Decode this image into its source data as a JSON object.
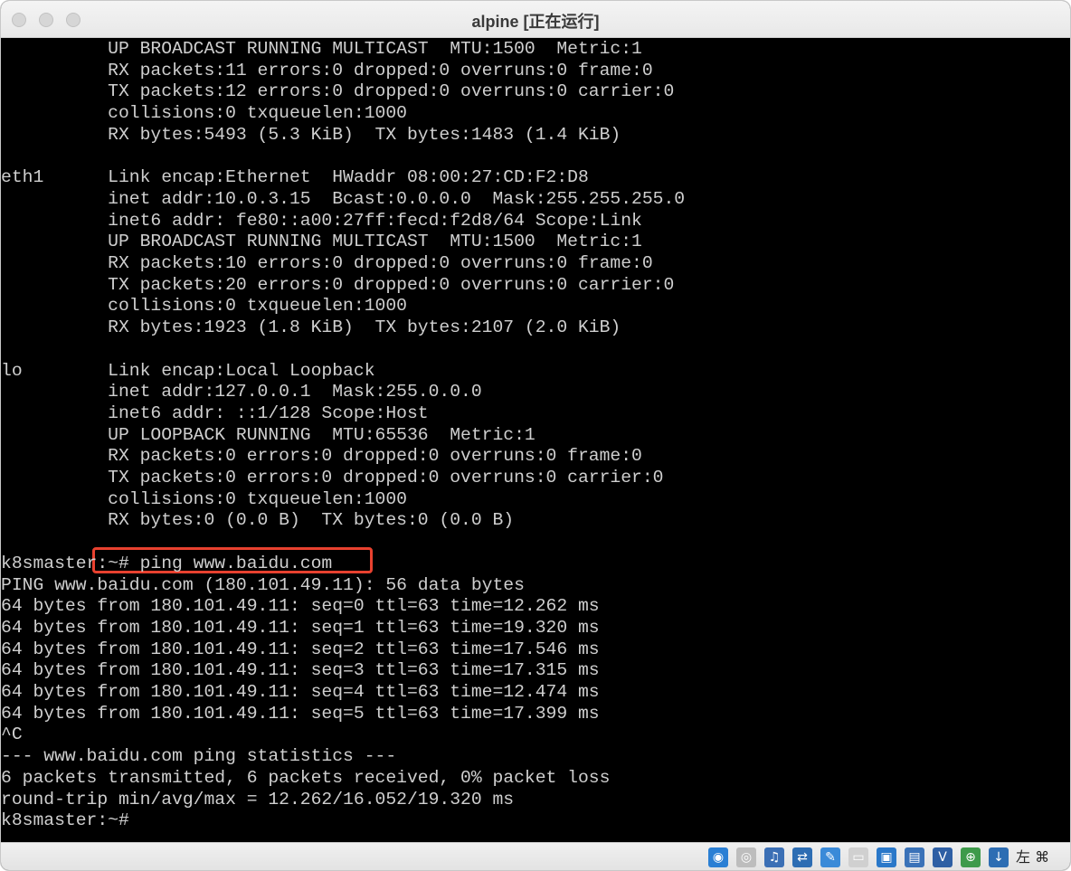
{
  "window": {
    "title": "alpine [正在运行]"
  },
  "terminal": {
    "lines": [
      "          UP BROADCAST RUNNING MULTICAST  MTU:1500  Metric:1",
      "          RX packets:11 errors:0 dropped:0 overruns:0 frame:0",
      "          TX packets:12 errors:0 dropped:0 overruns:0 carrier:0",
      "          collisions:0 txqueuelen:1000",
      "          RX bytes:5493 (5.3 KiB)  TX bytes:1483 (1.4 KiB)",
      "",
      "eth1      Link encap:Ethernet  HWaddr 08:00:27:CD:F2:D8",
      "          inet addr:10.0.3.15  Bcast:0.0.0.0  Mask:255.255.255.0",
      "          inet6 addr: fe80::a00:27ff:fecd:f2d8/64 Scope:Link",
      "          UP BROADCAST RUNNING MULTICAST  MTU:1500  Metric:1",
      "          RX packets:10 errors:0 dropped:0 overruns:0 frame:0",
      "          TX packets:20 errors:0 dropped:0 overruns:0 carrier:0",
      "          collisions:0 txqueuelen:1000",
      "          RX bytes:1923 (1.8 KiB)  TX bytes:2107 (2.0 KiB)",
      "",
      "lo        Link encap:Local Loopback",
      "          inet addr:127.0.0.1  Mask:255.0.0.0",
      "          inet6 addr: ::1/128 Scope:Host",
      "          UP LOOPBACK RUNNING  MTU:65536  Metric:1",
      "          RX packets:0 errors:0 dropped:0 overruns:0 frame:0",
      "          TX packets:0 errors:0 dropped:0 overruns:0 carrier:0",
      "          collisions:0 txqueuelen:1000",
      "          RX bytes:0 (0.0 B)  TX bytes:0 (0.0 B)",
      "",
      "k8smaster:~# ping www.baidu.com",
      "PING www.baidu.com (180.101.49.11): 56 data bytes",
      "64 bytes from 180.101.49.11: seq=0 ttl=63 time=12.262 ms",
      "64 bytes from 180.101.49.11: seq=1 ttl=63 time=19.320 ms",
      "64 bytes from 180.101.49.11: seq=2 ttl=63 time=17.546 ms",
      "64 bytes from 180.101.49.11: seq=3 ttl=63 time=17.315 ms",
      "64 bytes from 180.101.49.11: seq=4 ttl=63 time=12.474 ms",
      "64 bytes from 180.101.49.11: seq=5 ttl=63 time=17.399 ms",
      "^C",
      "--- www.baidu.com ping statistics ---",
      "6 packets transmitted, 6 packets received, 0% packet loss",
      "round-trip min/avg/max = 12.262/16.052/19.320 ms",
      "k8smaster:~#"
    ]
  },
  "statusbar": {
    "host_key": "左 ⌘",
    "icons": [
      {
        "name": "hard-disk-icon",
        "glyph": "◉",
        "color": "#2a7fd4"
      },
      {
        "name": "optical-drive-icon",
        "glyph": "◎",
        "color": "#bdbdbd"
      },
      {
        "name": "audio-icon",
        "glyph": "♫",
        "color": "#3b6fb5"
      },
      {
        "name": "network-icon",
        "glyph": "⇄",
        "color": "#2d6db3"
      },
      {
        "name": "usb-icon",
        "glyph": "✎",
        "color": "#3a8ad8"
      },
      {
        "name": "shared-folder-icon",
        "glyph": "▭",
        "color": "#d0d0d0"
      },
      {
        "name": "display-icon",
        "glyph": "▣",
        "color": "#2a78c9"
      },
      {
        "name": "recording-icon",
        "glyph": "▤",
        "color": "#3a72b8"
      },
      {
        "name": "vm-icon",
        "glyph": "V",
        "color": "#2e5fa4"
      },
      {
        "name": "mouse-integration-icon",
        "glyph": "⊕",
        "color": "#3e9a4a"
      },
      {
        "name": "keyboard-capture-icon",
        "glyph": "↓",
        "color": "#2d6db3"
      }
    ]
  }
}
